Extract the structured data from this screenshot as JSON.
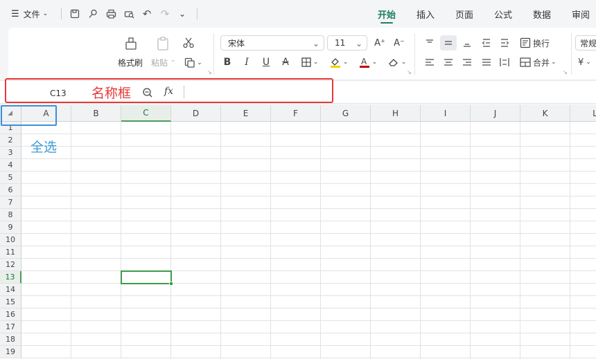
{
  "menu": {
    "file_label": "文件",
    "tabs": [
      {
        "label": "开始",
        "active": true
      },
      {
        "label": "插入"
      },
      {
        "label": "页面"
      },
      {
        "label": "公式"
      },
      {
        "label": "数据"
      },
      {
        "label": "审阅"
      }
    ]
  },
  "ribbon": {
    "format_painter": "格式刷",
    "paste": "粘贴",
    "font_name": "宋体",
    "font_size": "11",
    "wrap": "换行",
    "merge": "合并",
    "number_format": "常规",
    "currency_symbol": "¥"
  },
  "formula_bar": {
    "name_box_value": "C13",
    "fx_label": "fx"
  },
  "annotations": {
    "name_box_label": "名称框",
    "select_all_label": "全选"
  },
  "sheet": {
    "columns": [
      "A",
      "B",
      "C",
      "D",
      "E",
      "F",
      "G",
      "H",
      "I",
      "J",
      "K",
      "L"
    ],
    "rows": [
      "1",
      "2",
      "3",
      "4",
      "5",
      "6",
      "7",
      "8",
      "9",
      "10",
      "11",
      "12",
      "13",
      "14",
      "15",
      "16",
      "17",
      "18",
      "19"
    ],
    "active_column": "C",
    "active_row": "13"
  },
  "colors": {
    "accent": "#1f7f5c",
    "annotation_red": "#e53935",
    "annotation_blue": "#3c8fd8",
    "selection": "#3f9a4a"
  }
}
